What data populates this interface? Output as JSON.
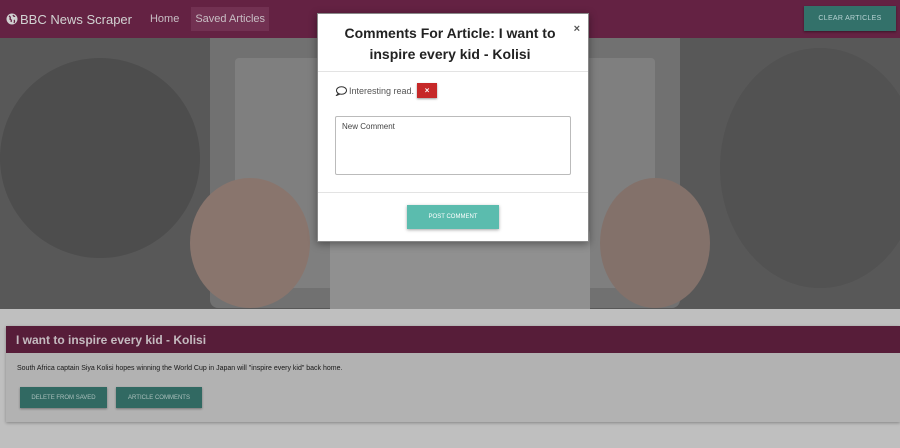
{
  "navbar": {
    "brand": "BBC News Scraper",
    "links": [
      "Home",
      "Saved Articles"
    ],
    "clear_label": "CLEAR ARTICLES"
  },
  "article": {
    "title": "I want to inspire every kid - Kolisi",
    "summary": "South Africa captain Siya Kolisi hopes winning the World Cup in Japan will \"inspire every kid\" back home.",
    "delete_label": "DELETE FROM SAVED",
    "comments_label": "ARTICLE COMMENTS"
  },
  "modal": {
    "title": "Comments For Article: I want to inspire every kid - Kolisi",
    "close_glyph": "×",
    "comments": [
      {
        "text": "Interesting read.",
        "delete_glyph": "×"
      }
    ],
    "comment_placeholder": "New Comment",
    "post_label": "POST COMMENT"
  },
  "colors": {
    "navbar": "#7a2a52",
    "card_header": "#6b2446",
    "teal_button": "#3f8a82",
    "post_button": "#5bbcae",
    "delete_button": "#c62828"
  },
  "icons": {
    "brand": "globe-icon",
    "comment": "speech-bubble-icon"
  }
}
